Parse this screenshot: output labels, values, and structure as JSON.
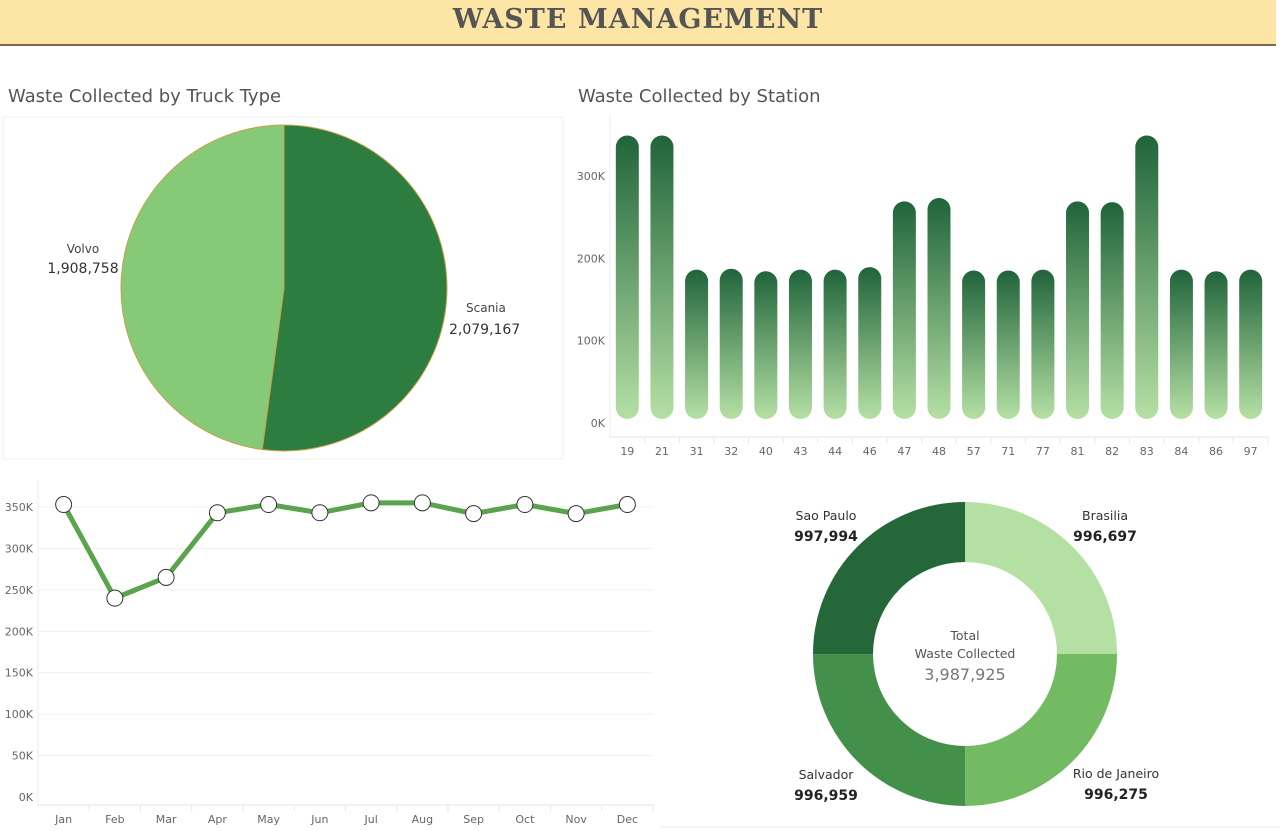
{
  "header": {
    "title": "WASTE MANAGEMENT"
  },
  "colors": {
    "header_bg": "#fde6a5",
    "scania": "#2e7d40",
    "volvo": "#86c976",
    "bar_top": "#20643a",
    "bar_bottom": "#b5e0a4",
    "line": "#5aa44e",
    "donut_sao_paulo": "#24683a",
    "donut_brasilia": "#b5e0a4",
    "donut_rio": "#73bb62",
    "donut_salvador": "#43904b"
  },
  "chart_data": [
    {
      "type": "pie",
      "title": "Waste Collected by Truck Type",
      "slices": [
        {
          "name": "Scania",
          "value": 2079167,
          "label": "2,079,167"
        },
        {
          "name": "Volvo",
          "value": 1908758,
          "label": "1,908,758"
        }
      ]
    },
    {
      "type": "bar",
      "title": "Waste Collected by Station",
      "categories": [
        "19",
        "21",
        "31",
        "32",
        "40",
        "43",
        "44",
        "46",
        "47",
        "48",
        "57",
        "71",
        "77",
        "81",
        "82",
        "83",
        "84",
        "86",
        "97"
      ],
      "values": [
        350000,
        350000,
        187000,
        188000,
        185000,
        187000,
        187000,
        190000,
        270000,
        274000,
        186000,
        186000,
        187000,
        270000,
        269000,
        350000,
        187000,
        185000,
        187000
      ],
      "ylim": [
        0,
        350000
      ],
      "yticks": [
        {
          "value": 0,
          "label": "0K"
        },
        {
          "value": 100000,
          "label": "100K"
        },
        {
          "value": 200000,
          "label": "200K"
        },
        {
          "value": 300000,
          "label": "300K"
        }
      ]
    },
    {
      "type": "line",
      "title": "",
      "categories": [
        "Jan",
        "Feb",
        "Mar",
        "Apr",
        "May",
        "Jun",
        "Jul",
        "Aug",
        "Sep",
        "Oct",
        "Nov",
        "Dec"
      ],
      "values": [
        353000,
        240000,
        265000,
        343000,
        353000,
        343000,
        355000,
        355000,
        342000,
        353000,
        342000,
        353000
      ],
      "ylim": [
        0,
        365000
      ],
      "yticks": [
        {
          "value": 0,
          "label": "0K"
        },
        {
          "value": 50000,
          "label": "50K"
        },
        {
          "value": 100000,
          "label": "100K"
        },
        {
          "value": 150000,
          "label": "150K"
        },
        {
          "value": 200000,
          "label": "200K"
        },
        {
          "value": 250000,
          "label": "250K"
        },
        {
          "value": 300000,
          "label": "300K"
        },
        {
          "value": 350000,
          "label": "350K"
        }
      ]
    },
    {
      "type": "pie",
      "subtype": "donut",
      "center_label": [
        "Total",
        "Waste Collected"
      ],
      "center_value": "3,987,925",
      "slices": [
        {
          "name": "Brasilia",
          "value": 996697,
          "label": "996,697"
        },
        {
          "name": "Rio de Janeiro",
          "value": 996275,
          "label": "996,275"
        },
        {
          "name": "Salvador",
          "value": 996959,
          "label": "996,959"
        },
        {
          "name": "Sao Paulo",
          "value": 997994,
          "label": "997,994"
        }
      ]
    }
  ]
}
